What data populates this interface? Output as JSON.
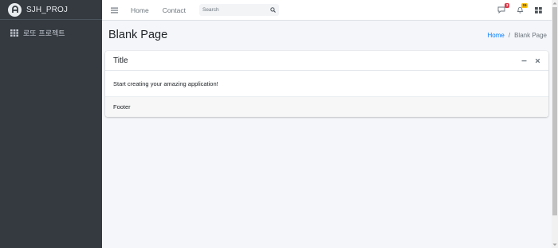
{
  "sidebar": {
    "brand": "SJH_PROJ",
    "brand_logo": "brand-logo-icon",
    "items": [
      {
        "label": "로또 프로젝트",
        "icon": "grid-icon"
      }
    ]
  },
  "topbar": {
    "menu_icon": "hamburger-icon",
    "nav": [
      {
        "label": "Home"
      },
      {
        "label": "Contact"
      }
    ],
    "search": {
      "placeholder": "Search",
      "icon": "search-icon"
    },
    "messages": {
      "icon": "comments-icon",
      "badge": "3",
      "badge_color": "#dc3545"
    },
    "notifications": {
      "icon": "bell-icon",
      "badge": "15",
      "badge_color": "#ffc107"
    },
    "apps_icon": "th-large-icon"
  },
  "content_header": {
    "title": "Blank Page",
    "breadcrumb": {
      "home": "Home",
      "separator": "/",
      "current": "Blank Page"
    }
  },
  "card": {
    "title": "Title",
    "tools": [
      "minus-icon",
      "close-icon"
    ],
    "body": "Start creating your amazing application!",
    "footer": "Footer"
  },
  "colors": {
    "sidebar_bg": "#343a40",
    "content_bg": "#f4f6f9",
    "link": "#007bff"
  }
}
